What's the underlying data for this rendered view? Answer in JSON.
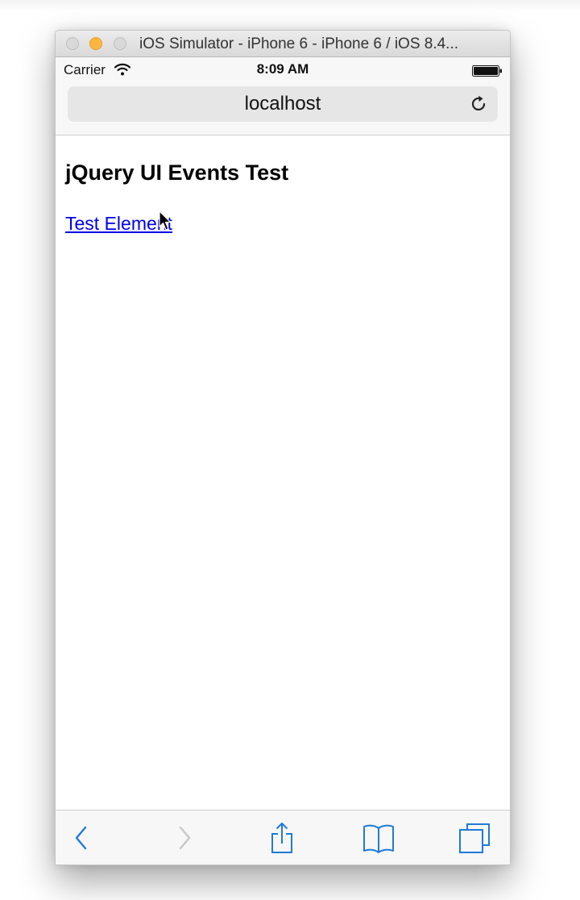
{
  "window": {
    "title": "iOS Simulator - iPhone 6 - iPhone 6 / iOS 8.4..."
  },
  "status_bar": {
    "carrier": "Carrier",
    "time": "8:09 AM"
  },
  "address_bar": {
    "url": "localhost"
  },
  "page": {
    "heading": "jQuery UI Events Test",
    "link_text": "Test Element"
  },
  "colors": {
    "accent": "#1f7bd6",
    "link": "#0000ee",
    "minimize_button": "#fdb63f",
    "disabled_forward": "#c7c7cc"
  },
  "toolbar": {
    "icons": [
      "chevron-left-icon",
      "chevron-right-icon",
      "share-icon",
      "bookmarks-icon",
      "tabs-icon"
    ]
  }
}
